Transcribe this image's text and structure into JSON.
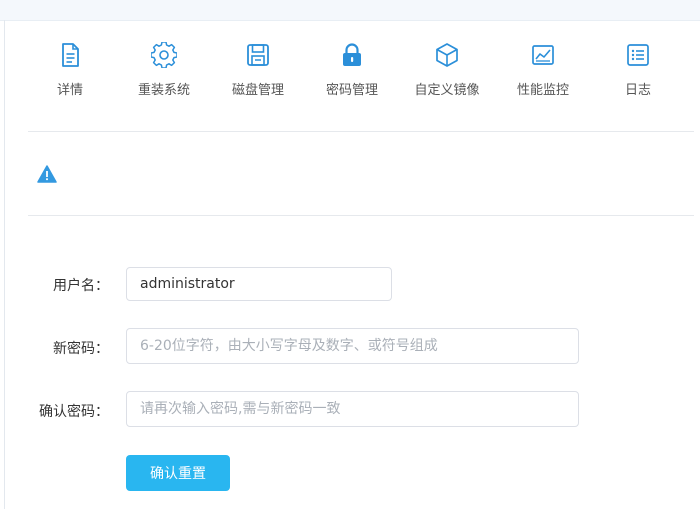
{
  "colors": {
    "accent": "#29b6f0",
    "icon": "#2b8fd9",
    "warning": "#3399e0"
  },
  "toolbar": {
    "items": [
      {
        "label": "详情",
        "icon": "document-icon"
      },
      {
        "label": "重装系统",
        "icon": "gear-icon"
      },
      {
        "label": "磁盘管理",
        "icon": "disk-icon"
      },
      {
        "label": "密码管理",
        "icon": "lock-icon"
      },
      {
        "label": "自定义镜像",
        "icon": "cube-icon"
      },
      {
        "label": "性能监控",
        "icon": "chart-icon"
      },
      {
        "label": "日志",
        "icon": "list-icon"
      }
    ]
  },
  "alert": {
    "icon": "warning-icon"
  },
  "form": {
    "username_label": "用户名：",
    "username_value": "administrator",
    "new_password_label": "新密码：",
    "new_password_placeholder": "6-20位字符，由大小写字母及数字、或符号组成",
    "confirm_password_label": "确认密码：",
    "confirm_password_placeholder": "请再次输入密码,需与新密码一致",
    "submit_label": "确认重置"
  }
}
